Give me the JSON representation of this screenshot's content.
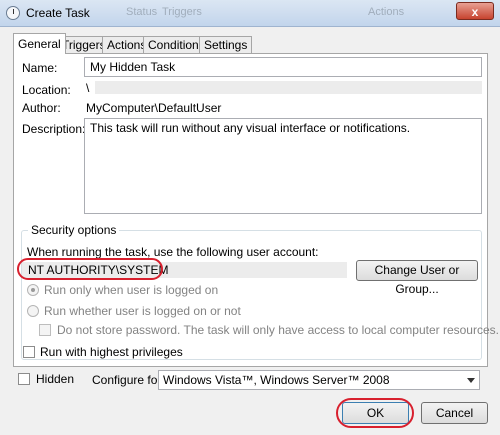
{
  "window": {
    "title": "Create Task",
    "bg_status_ghost": "Status",
    "bg_triggers_ghost": "Triggers",
    "bg_actions_ghost": "Actions",
    "close_label": "x"
  },
  "tabs": [
    {
      "label": "General",
      "active": true
    },
    {
      "label": "Triggers",
      "active": false
    },
    {
      "label": "Actions",
      "active": false
    },
    {
      "label": "Conditions",
      "active": false
    },
    {
      "label": "Settings",
      "active": false
    }
  ],
  "general": {
    "name_label": "Name:",
    "name_value": "My Hidden Task",
    "location_label": "Location:",
    "location_value": "\\",
    "author_label": "Author:",
    "author_value": "MyComputer\\DefaultUser",
    "description_label": "Description:",
    "description_value": "This task will run without any visual interface or notifications."
  },
  "security": {
    "group_title": "Security options",
    "account_prompt": "When running the task, use the following user account:",
    "account_value": "NT AUTHORITY\\SYSTEM",
    "change_user_button": "Change User or Group...",
    "radio_logged_on": "Run only when user is logged on",
    "radio_logged_on_checked": true,
    "radio_whether": "Run whether user is logged on or not",
    "radio_whether_checked": false,
    "no_store_password": "Do not store password.  The task will only have access to local computer resources.",
    "highest_privileges": "Run with highest privileges"
  },
  "footer": {
    "hidden_label": "Hidden",
    "configure_label": "Configure for:",
    "configure_value": "Windows Vista™, Windows Server™ 2008",
    "ok_label": "OK",
    "cancel_label": "Cancel"
  },
  "colors": {
    "highlight_red": "#d8202e",
    "titlebar_top": "#dbe6f3"
  }
}
